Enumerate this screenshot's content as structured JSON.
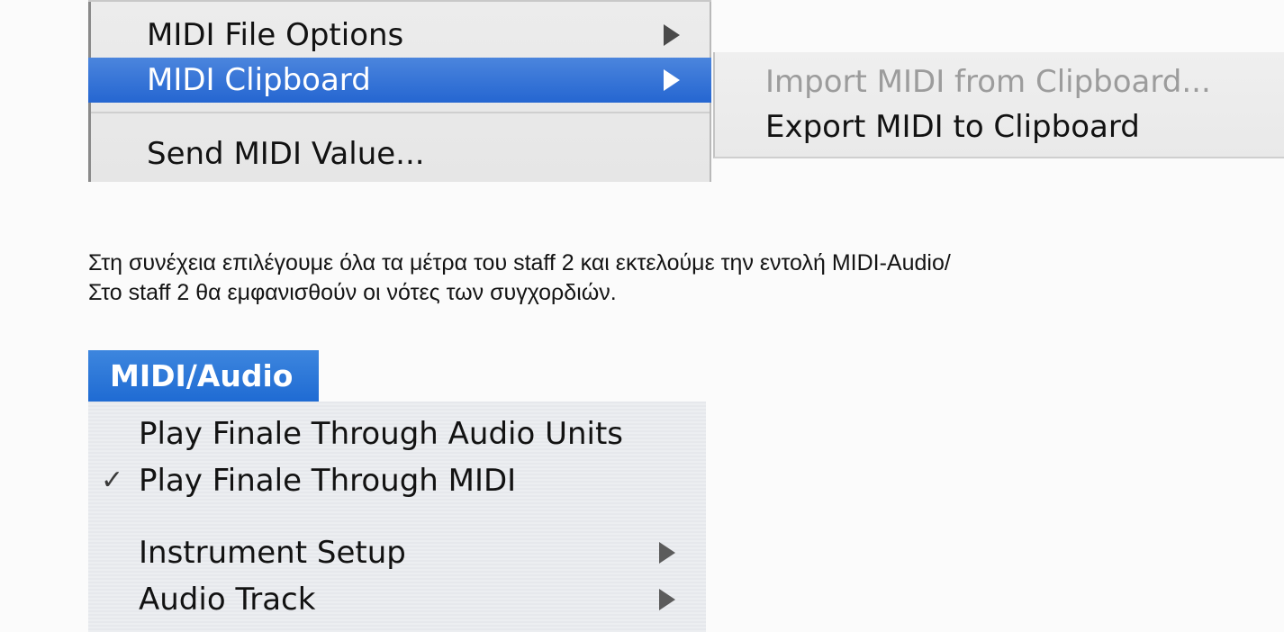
{
  "midi_menu": {
    "items": [
      {
        "label": "MIDI File Options",
        "has_submenu": true
      },
      {
        "label": "MIDI Clipboard",
        "has_submenu": true,
        "highlighted": true
      },
      {
        "label": "Send MIDI Value..."
      }
    ]
  },
  "clipboard_submenu": {
    "items": [
      {
        "label": "Import MIDI from Clipboard...",
        "enabled": false
      },
      {
        "label": "Export MIDI to Clipboard",
        "enabled": true
      }
    ]
  },
  "instructions": {
    "line1": "Στη συνέχεια επιλέγουμε όλα τα μέτρα του staff 2 και εκτελούμε την εντολή MIDI-Audio/",
    "line2": "Στο staff 2 θα εμφανισθούν οι νότες των συγχορδιών."
  },
  "midi_audio_menu": {
    "title": "MIDI/Audio",
    "items": [
      {
        "label": "Play Finale Through Audio Units"
      },
      {
        "label": "Play Finale Through MIDI",
        "checked": true,
        "check_glyph": "✓"
      },
      {
        "label": "Instrument Setup",
        "has_submenu": true
      },
      {
        "label": "Audio Track",
        "has_submenu": true
      }
    ]
  },
  "colors": {
    "highlight": "#2566d1",
    "menu_bg": "#e9e9e9",
    "disabled_text": "#9c9c9c"
  }
}
